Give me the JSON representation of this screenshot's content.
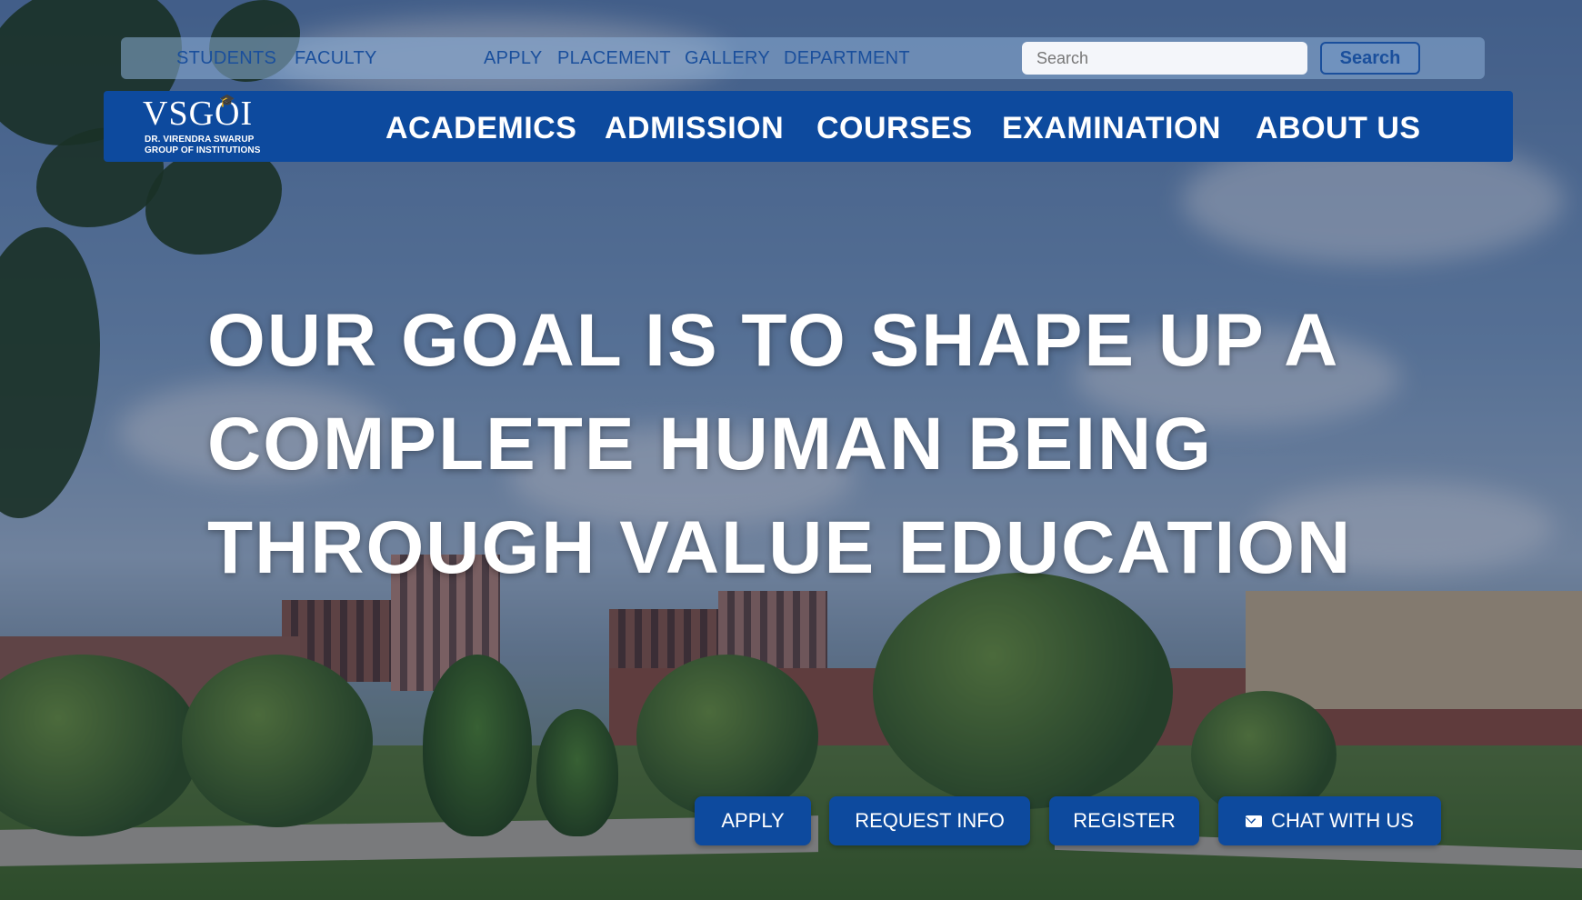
{
  "top_bar": {
    "links": [
      "STUDENTS",
      "FACULTY",
      "APPLY",
      "PLACEMENT",
      "GALLERY",
      "DEPARTMENT"
    ],
    "search": {
      "placeholder": "Search",
      "button_label": "Search"
    }
  },
  "main_nav": {
    "logo": {
      "mark": "VSGOI",
      "line1": "DR. VIRENDRA SWARUP",
      "line2": "GROUP OF INSTITUTIONS"
    },
    "items": [
      "ACADEMICS",
      "ADMISSION",
      "COURSES",
      "EXAMINATION",
      "ABOUT US"
    ]
  },
  "hero": {
    "headline_lines": [
      "OUR GOAL IS TO SHAPE UP A",
      "COMPLETE HUMAN BEING",
      "THROUGH VALUE EDUCATION"
    ]
  },
  "cta": {
    "apply": "APPLY",
    "request_info": "REQUEST INFO",
    "register": "REGISTER",
    "chat": "CHAT WITH US"
  },
  "colors": {
    "brand_blue": "#0d4a9e",
    "top_link": "#1a4f9c"
  },
  "icons": {
    "chat": "mail-icon"
  }
}
